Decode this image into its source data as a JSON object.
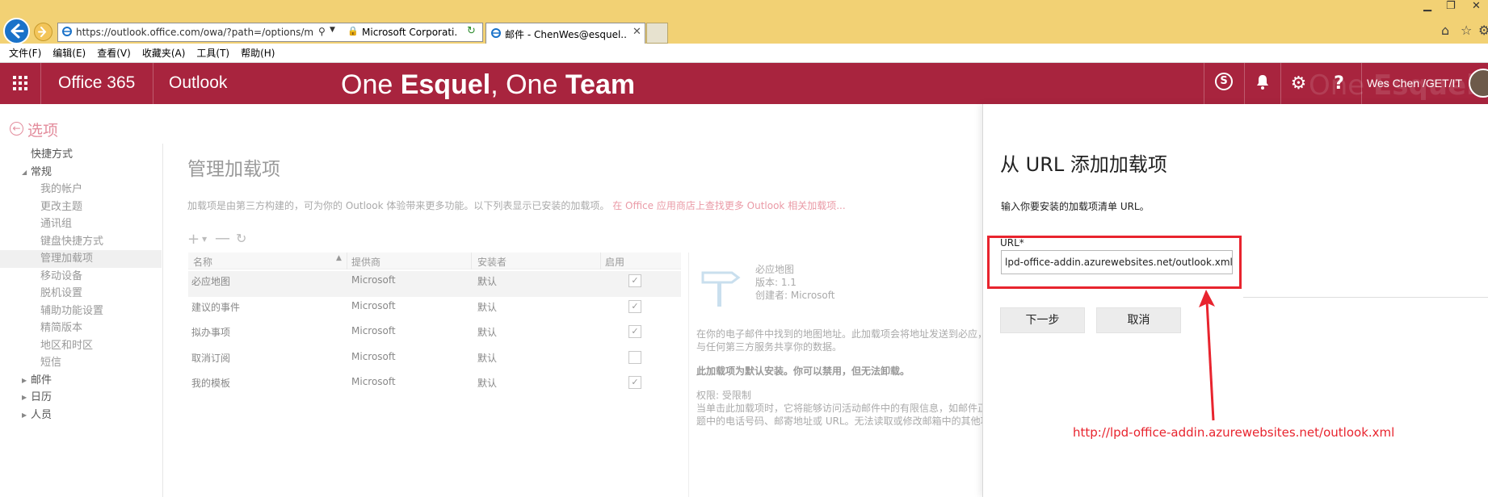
{
  "browser": {
    "address_url": "https://outlook.office.com/owa/?path=/options/m",
    "address_host_hint": "Microsoft Corporati...",
    "tab_title": "邮件 - ChenWes@esquel....",
    "menu": [
      "文件(F)",
      "编辑(E)",
      "查看(V)",
      "收藏夹(A)",
      "工具(T)",
      "帮助(H)"
    ]
  },
  "suitebar": {
    "app1": "Office 365",
    "app2": "Outlook",
    "tagline_parts": [
      "One ",
      "Esquel",
      ", One ",
      "Team"
    ],
    "user": "Wes Chen /GET/IT",
    "bg_color": "#a8243e"
  },
  "sidebar": {
    "back_label": "选项",
    "items": [
      {
        "label": "快捷方式",
        "kind": "head"
      },
      {
        "label": "常规",
        "kind": "head-open"
      },
      {
        "label": "我的帐户",
        "kind": "sub"
      },
      {
        "label": "更改主题",
        "kind": "sub"
      },
      {
        "label": "通讯组",
        "kind": "sub"
      },
      {
        "label": "键盘快捷方式",
        "kind": "sub"
      },
      {
        "label": "管理加载项",
        "kind": "sub-selected"
      },
      {
        "label": "移动设备",
        "kind": "sub"
      },
      {
        "label": "脱机设置",
        "kind": "sub"
      },
      {
        "label": "辅助功能设置",
        "kind": "sub"
      },
      {
        "label": "精简版本",
        "kind": "sub"
      },
      {
        "label": "地区和时区",
        "kind": "sub"
      },
      {
        "label": "短信",
        "kind": "sub"
      },
      {
        "label": "邮件",
        "kind": "head-closed"
      },
      {
        "label": "日历",
        "kind": "head-closed"
      },
      {
        "label": "人员",
        "kind": "head-closed"
      }
    ]
  },
  "main": {
    "title": "管理加载项",
    "description": "加载项是由第三方构建的，可为你的 Outlook 体验带来更多功能。以下列表显示已安装的加载项。",
    "store_link": "在 Office 应用商店上查找更多 Outlook 相关加载项...",
    "columns": [
      "名称",
      "提供商",
      "安装者",
      "启用"
    ],
    "rows": [
      {
        "name": "必应地图",
        "provider": "Microsoft",
        "installer": "默认",
        "enabled": true
      },
      {
        "name": "建议的事件",
        "provider": "Microsoft",
        "installer": "默认",
        "enabled": true
      },
      {
        "name": "拟办事项",
        "provider": "Microsoft",
        "installer": "默认",
        "enabled": true
      },
      {
        "name": "取消订阅",
        "provider": "Microsoft",
        "installer": "默认",
        "enabled": false
      },
      {
        "name": "我的模板",
        "provider": "Microsoft",
        "installer": "默认",
        "enabled": true
      }
    ]
  },
  "details": {
    "name": "必应地图",
    "version": "版本: 1.1",
    "creator": "创建者: Microsoft",
    "desc": "在你的电子邮件中找到的地图地址。此加载项会将地址发送到必应，",
    "desc2": "与任何第三方服务共享你的数据。",
    "default_note": "此加载项为默认安装。你可以禁用，但无法卸载。",
    "perm_title": "权限: 受限制",
    "perm_desc": "当单击此加载项时，它将能够访问活动邮件中的有限信息，如邮件正",
    "perm_desc2": "题中的电话号码、邮寄地址或 URL。无法读取或修改邮箱中的其他项"
  },
  "panel": {
    "title": "从 URL 添加加载项",
    "instruction": "输入你要安装的加载项清单 URL。",
    "url_label": "URL*",
    "url_value": "lpd-office-addin.azurewebsites.net/outlook.xml",
    "next_label": "下一步",
    "cancel_label": "取消"
  },
  "annotation": {
    "text": "http://lpd-office-addin.azurewebsites.net/outlook.xml",
    "color": "#e8242e"
  }
}
